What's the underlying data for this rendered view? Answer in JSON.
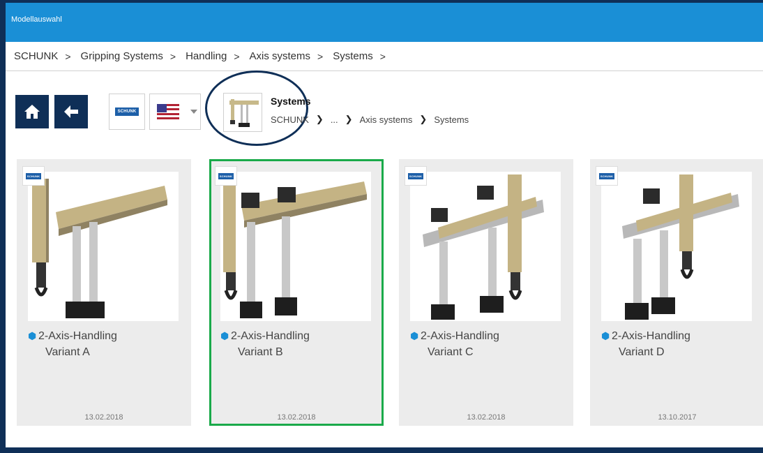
{
  "window": {
    "title": "Modellauswahl"
  },
  "breadcrumb": [
    "SCHUNK",
    "Gripping Systems",
    "Handling",
    "Axis systems",
    "Systems"
  ],
  "breadcrumb_separator": ">",
  "toolbar": {
    "home_icon": "home-icon",
    "back_icon": "arrow-left-icon",
    "catalog_logo_text": "SCHUNK",
    "language": "flag-us"
  },
  "current_category": {
    "title": "Systems",
    "path": [
      "SCHUNK",
      "...",
      "Axis systems",
      "Systems"
    ]
  },
  "colors": {
    "titlebar": "#1a8fd6",
    "navy": "#0f2f57",
    "selected_outline": "#1aaa4a",
    "card_bg": "#ececec"
  },
  "cards": [
    {
      "name": "2-Axis-Handling",
      "variant": "Variant A",
      "date": "13.02.2018",
      "selected": false
    },
    {
      "name": "2-Axis-Handling",
      "variant": "Variant B",
      "date": "13.02.2018",
      "selected": true
    },
    {
      "name": "2-Axis-Handling",
      "variant": "Variant C",
      "date": "13.02.2018",
      "selected": false
    },
    {
      "name": "2-Axis-Handling",
      "variant": "Variant D",
      "date": "13.10.2017",
      "selected": false
    }
  ]
}
